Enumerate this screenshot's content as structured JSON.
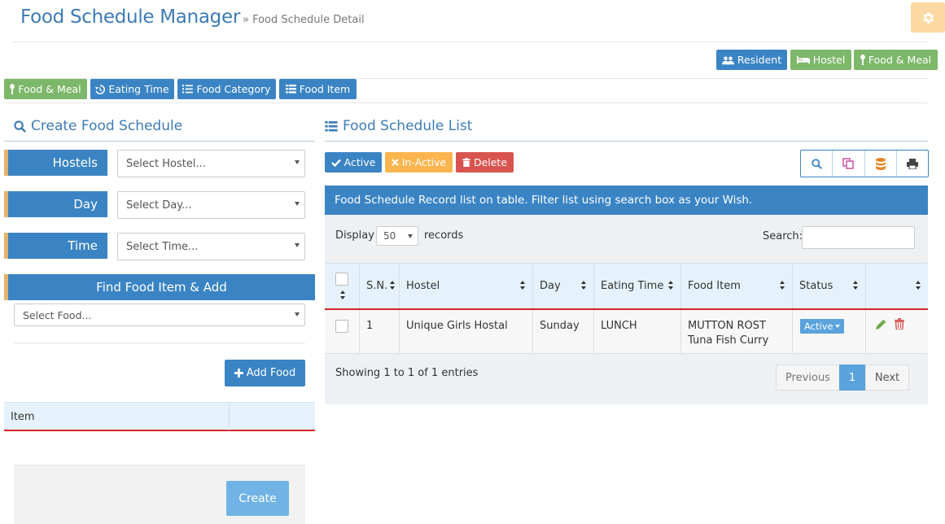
{
  "header": {
    "title": "Food Schedule Manager",
    "breadcrumb": "» Food Schedule Detail"
  },
  "colors": {
    "primary": "#3a84c4",
    "success": "#7db76a",
    "warning": "#fcb54e",
    "danger": "#d9534f",
    "settings": "#fcd9a2",
    "accent_border": "#e3b26b"
  },
  "top_nav": [
    {
      "label": "Resident",
      "icon": "users-icon"
    },
    {
      "label": "Hostel",
      "icon": "bed-icon"
    },
    {
      "label": "Food & Meal",
      "icon": "spoon-icon"
    }
  ],
  "sub_nav": [
    {
      "label": "Food & Meal",
      "icon": "spoon-icon"
    },
    {
      "label": "Eating Time",
      "icon": "history-icon"
    },
    {
      "label": "Food Category",
      "icon": "list-ol-icon"
    },
    {
      "label": "Food Item",
      "icon": "list-icon"
    }
  ],
  "create_form": {
    "title": "Create Food Schedule",
    "hostels_label": "Hostels",
    "hostels_placeholder": "Select Hostel...",
    "day_label": "Day",
    "day_placeholder": "Select Day...",
    "time_label": "Time",
    "time_placeholder": "Select Time...",
    "find_label": "Find Food Item & Add",
    "food_placeholder": "Select Food...",
    "add_food_label": "Add Food",
    "item_column": "Item",
    "create_label": "Create"
  },
  "list": {
    "title": "Food Schedule List",
    "active_label": "Active",
    "inactive_label": "In-Active",
    "delete_label": "Delete",
    "tools": [
      "search-icon",
      "copy-icon",
      "database-icon",
      "print-icon"
    ],
    "info": "Food Schedule Record list on table. Filter list using search box as your Wish.",
    "display_label": "Display",
    "records_per_page": "50",
    "records_label": "records",
    "search_label": "Search:",
    "columns": [
      "S.N.",
      "Hostel",
      "Day",
      "Eating Time",
      "Food Item",
      "Status"
    ],
    "rows": [
      {
        "sn": "1",
        "hostel": "Unique Girls Hostal",
        "day": "Sunday",
        "eating_time": "LUNCH",
        "food_items": [
          "MUTTON ROST",
          "Tuna Fish Curry"
        ],
        "status": "Active"
      }
    ],
    "summary": "Showing 1 to 1 of 1 entries",
    "pagination": {
      "previous": "Previous",
      "current": "1",
      "next": "Next"
    }
  }
}
